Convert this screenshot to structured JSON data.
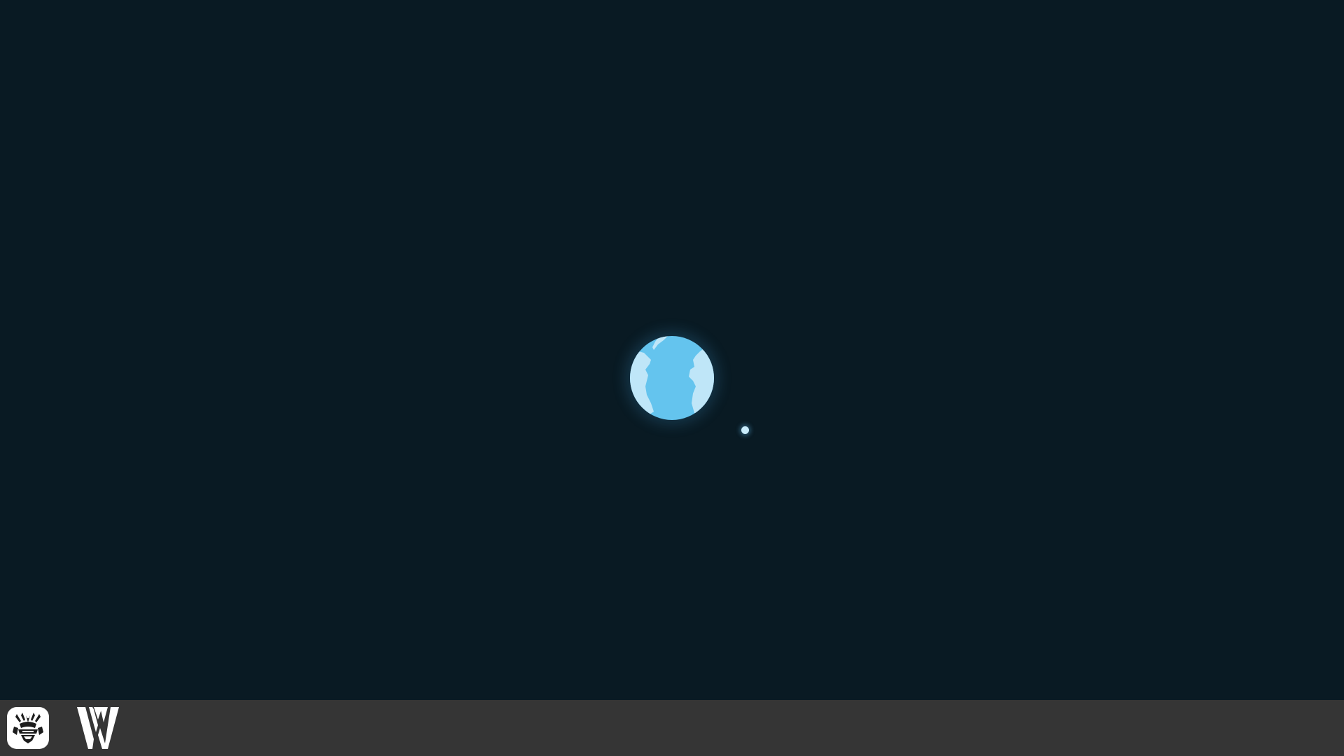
{
  "desktop": {
    "background_color": "#091a23"
  },
  "loader": {
    "earth_icon": "earth-globe-icon",
    "moon_icon": "moon-dot-icon",
    "ocean_color": "#64c4ee",
    "land_color": "#bfe6f8"
  },
  "taskbar": {
    "background_color": "#353535",
    "apps": [
      {
        "name": "unsc-emblem-app",
        "icon": "unsc-emblem-icon"
      },
      {
        "name": "w-logo-app",
        "icon": "w-logo-icon"
      }
    ]
  }
}
